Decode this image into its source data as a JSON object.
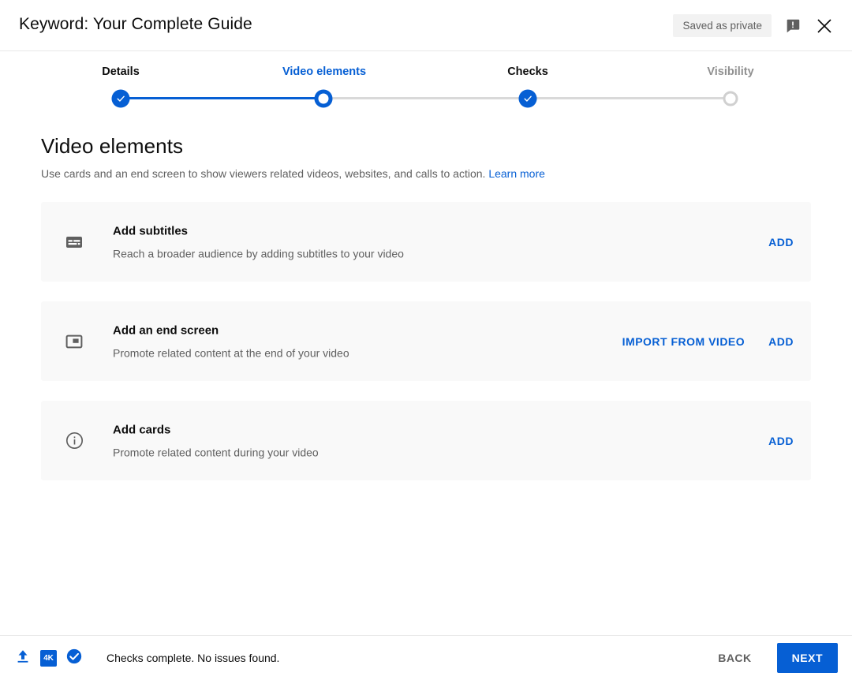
{
  "header": {
    "title": "Keyword: Your Complete Guide",
    "saved_badge": "Saved as private",
    "feedback_icon": "feedback-exclamation-icon",
    "close_icon": "close-icon"
  },
  "stepper": {
    "steps": [
      {
        "label": "Details",
        "state": "done"
      },
      {
        "label": "Video elements",
        "state": "current"
      },
      {
        "label": "Checks",
        "state": "done"
      },
      {
        "label": "Visibility",
        "state": "todo"
      }
    ]
  },
  "main": {
    "title": "Video elements",
    "description": "Use cards and an end screen to show viewers related videos, websites, and calls to action.",
    "learn_more": "Learn more",
    "cards": [
      {
        "icon": "subtitles-icon",
        "title": "Add subtitles",
        "subtitle": "Reach a broader audience by adding subtitles to your video",
        "actions": [
          "ADD"
        ]
      },
      {
        "icon": "end-screen-icon",
        "title": "Add an end screen",
        "subtitle": "Promote related content at the end of your video",
        "actions": [
          "IMPORT FROM VIDEO",
          "ADD"
        ]
      },
      {
        "icon": "info-circle-icon",
        "title": "Add cards",
        "subtitle": "Promote related content during your video",
        "actions": [
          "ADD"
        ]
      }
    ]
  },
  "footer": {
    "upload_icon": "upload-icon",
    "resolution_badge": "4K",
    "check_icon": "check-circle-icon",
    "status": "Checks complete. No issues found.",
    "back_label": "BACK",
    "next_label": "NEXT"
  },
  "colors": {
    "accent": "#065fd4",
    "text_primary": "#0d0d0d",
    "text_secondary": "#606060",
    "card_bg": "#f9f9f9",
    "badge_bg": "#f2f2f2",
    "icon_gray": "#5f5f5f"
  }
}
